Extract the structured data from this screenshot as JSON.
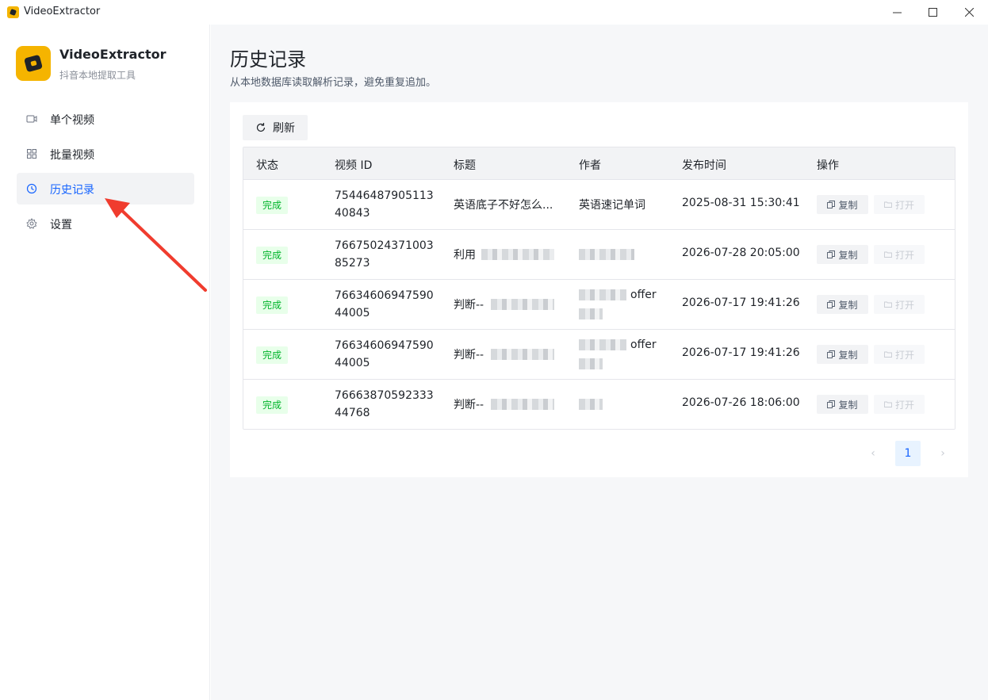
{
  "window": {
    "title": "VideoExtractor",
    "min_glyph": "—",
    "max_glyph": "☐",
    "close_glyph": "✕"
  },
  "brand": {
    "name": "VideoExtractor",
    "subtitle": "抖音本地提取工具"
  },
  "sidebar": {
    "items": [
      {
        "label": "单个视频",
        "icon": "video-icon",
        "active": false
      },
      {
        "label": "批量视频",
        "icon": "grid-icon",
        "active": false
      },
      {
        "label": "历史记录",
        "icon": "history-icon",
        "active": true
      },
      {
        "label": "设置",
        "icon": "gear-icon",
        "active": false
      }
    ]
  },
  "page": {
    "title": "历史记录",
    "description": "从本地数据库读取解析记录，避免重复追加。"
  },
  "toolbar": {
    "refresh_label": "刷新"
  },
  "table": {
    "headers": [
      "状态",
      "视频 ID",
      "标题",
      "作者",
      "发布时间",
      "操作"
    ],
    "rows": [
      {
        "status": "完成",
        "video_id": "7544648790511340843",
        "title": "英语底子不好怎么...",
        "author": "英语速记单词",
        "date": "2025-08-31 15:30:41",
        "copy": "复制",
        "open": "打开"
      },
      {
        "status": "完成",
        "video_id": "7667502437100385273",
        "title": "利用",
        "author": "",
        "date": "2026-07-28 20:05:00",
        "copy": "复制",
        "open": "打开"
      },
      {
        "status": "完成",
        "video_id": "7663460694759044005",
        "title": "判断--",
        "author": "offer",
        "date": "2026-07-17 19:41:26",
        "copy": "复制",
        "open": "打开"
      },
      {
        "status": "完成",
        "video_id": "7663460694759044005",
        "title": "判断--",
        "author": "offer",
        "date": "2026-07-17 19:41:26",
        "copy": "复制",
        "open": "打开"
      },
      {
        "status": "完成",
        "video_id": "7666387059233344768",
        "title": "判断--",
        "author": "",
        "date": "2026-07-26 18:06:00",
        "copy": "复制",
        "open": "打开"
      }
    ]
  },
  "pagination": {
    "current_page": "1",
    "prev_glyph": "‹",
    "next_glyph": "›"
  },
  "colors": {
    "accent": "#1664ff",
    "success": "#00b42a",
    "success_bg": "#e8ffea",
    "brand": "#f5b400",
    "annotation_arrow": "#f03c2e"
  }
}
